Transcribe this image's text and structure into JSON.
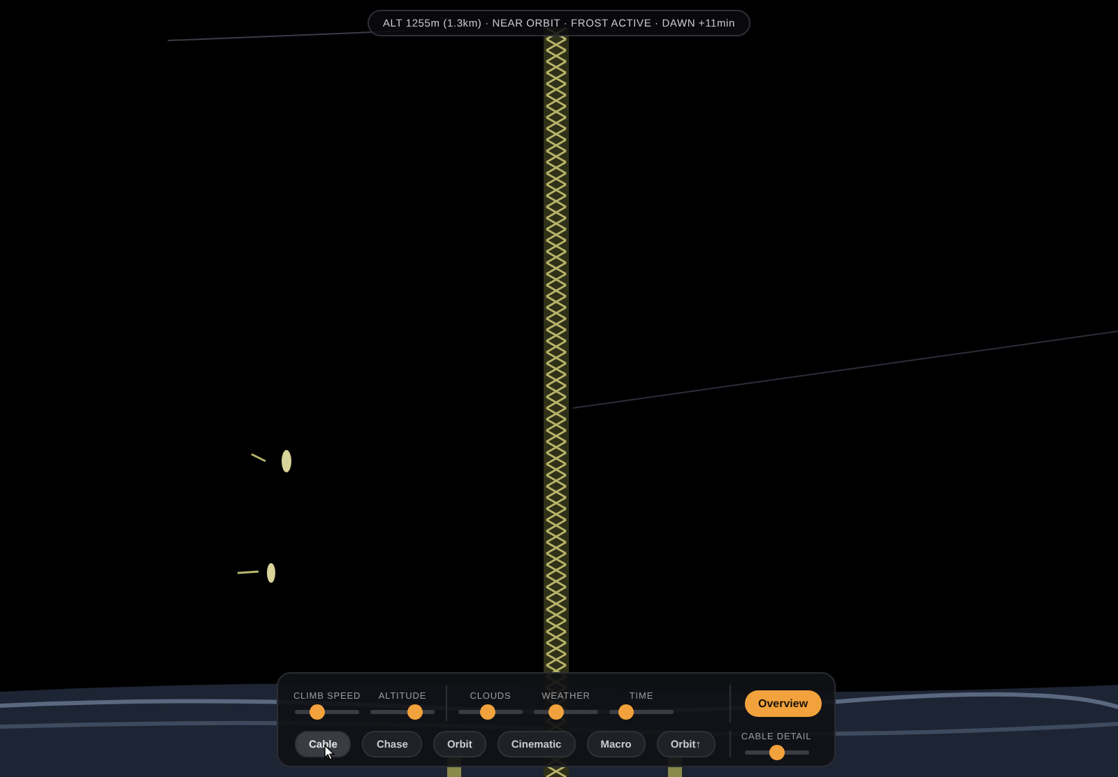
{
  "status_bar": {
    "text": "ALT 1255m (1.3km) · NEAR ORBIT · FROST ACTIVE · DAWN +11min"
  },
  "slider_groups": [
    {
      "sliders": [
        {
          "label": "CLIMB SPEED",
          "level": 0.35
        },
        {
          "label": "ALTITUDE",
          "level": 0.7
        }
      ]
    },
    {
      "sliders": [
        {
          "label": "CLOUDS",
          "level": 0.45
        },
        {
          "label": "WEATHER",
          "level": 0.35
        },
        {
          "label": "TIME",
          "level": 0.25
        }
      ]
    }
  ],
  "overview_button": {
    "label": "Overview"
  },
  "camera_modes": [
    {
      "label": "Cable",
      "selected": true
    },
    {
      "label": "Chase",
      "selected": false
    },
    {
      "label": "Orbit",
      "selected": false
    },
    {
      "label": "Cinematic",
      "selected": false
    },
    {
      "label": "Macro",
      "selected": false
    },
    {
      "label": "Orbit↑",
      "selected": false
    }
  ],
  "cable_detail": {
    "label": "CABLE DETAIL",
    "level": 0.5
  }
}
